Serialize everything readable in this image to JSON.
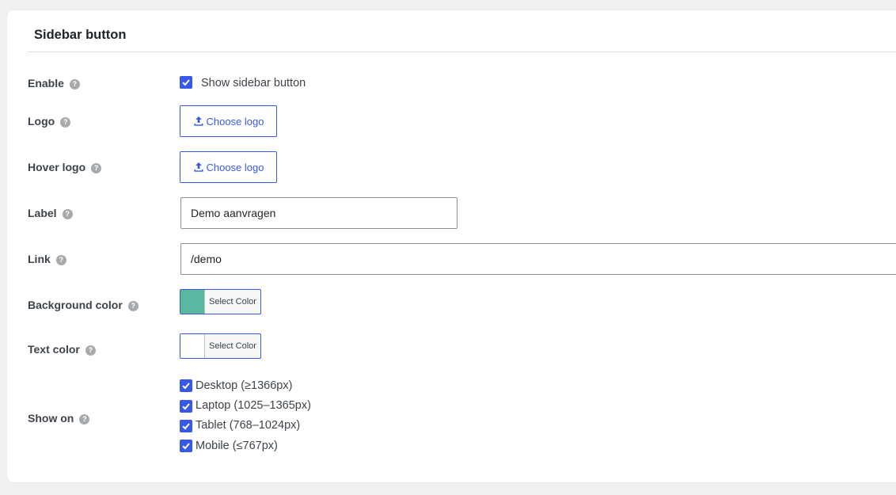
{
  "section": {
    "title": "Sidebar button"
  },
  "enable": {
    "label": "Enable",
    "checkbox_label": "Show sidebar button",
    "checked": true
  },
  "logo": {
    "label": "Logo",
    "button_label": "Choose logo"
  },
  "hover_logo": {
    "label": "Hover logo",
    "button_label": "Choose logo"
  },
  "label_field": {
    "label": "Label",
    "value": "Demo aanvragen"
  },
  "link_field": {
    "label": "Link",
    "value": "/demo"
  },
  "background_color": {
    "label": "Background color",
    "button_label": "Select Color",
    "value": "#5bb8a0"
  },
  "text_color": {
    "label": "Text color",
    "button_label": "Select Color",
    "value": "#ffffff"
  },
  "show_on": {
    "label": "Show on",
    "options": [
      {
        "label": "Desktop (≥1366px)",
        "checked": true
      },
      {
        "label": "Laptop (1025–1365px)",
        "checked": true
      },
      {
        "label": "Tablet (768–1024px)",
        "checked": true
      },
      {
        "label": "Mobile (≤767px)",
        "checked": true
      }
    ]
  },
  "icons": {
    "help": "question-mark-circle-icon",
    "upload": "upload-icon",
    "check": "checkmark-icon"
  },
  "colors": {
    "accent": "#3858e9",
    "help_icon": "#a7aaad"
  }
}
